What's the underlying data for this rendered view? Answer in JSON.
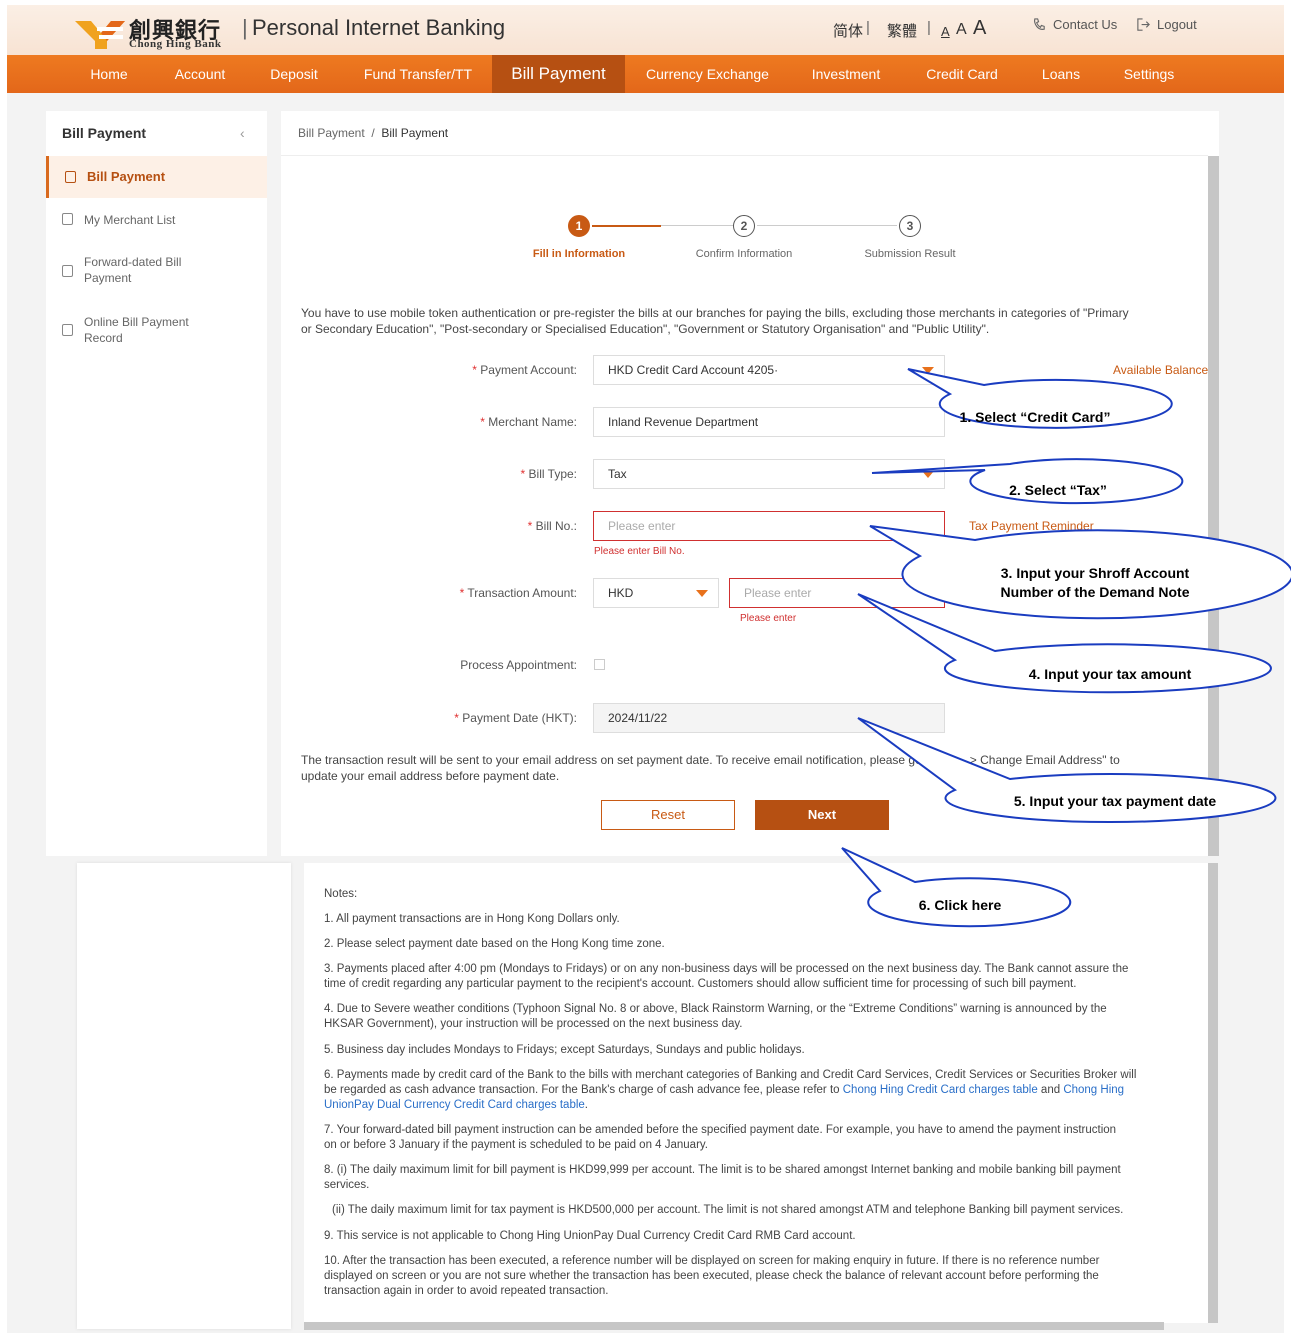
{
  "header": {
    "logo_cn": "創興銀行",
    "logo_en": "Chong Hing Bank",
    "title": "Personal Internet Banking",
    "lang_simplified": "简体",
    "lang_traditional": "繁體",
    "font_small": "A",
    "font_medium": "A",
    "font_large": "A",
    "contact_us": "Contact Us",
    "logout": "Logout"
  },
  "nav": [
    {
      "label": "Home"
    },
    {
      "label": "Account"
    },
    {
      "label": "Deposit"
    },
    {
      "label": "Fund Transfer/TT"
    },
    {
      "label": "Bill Payment"
    },
    {
      "label": "Currency Exchange"
    },
    {
      "label": "Investment"
    },
    {
      "label": "Credit Card"
    },
    {
      "label": "Loans"
    },
    {
      "label": "Settings"
    }
  ],
  "sidebar": {
    "title": "Bill Payment",
    "collapse": "‹",
    "items": [
      {
        "label": "Bill Payment",
        "active": true
      },
      {
        "label": "My Merchant List"
      },
      {
        "label": "Forward-dated Bill",
        "label2": "Payment"
      },
      {
        "label": "Online Bill Payment",
        "label2": "Record"
      }
    ]
  },
  "breadcrumb": {
    "parent": "Bill Payment",
    "separator": "/",
    "current": "Bill Payment"
  },
  "steps": [
    {
      "num": "1",
      "label": "Fill in Information"
    },
    {
      "num": "2",
      "label": "Confirm Information"
    },
    {
      "num": "3",
      "label": "Submission Result"
    }
  ],
  "intro": {
    "line1": "You have to use mobile token authentication or pre-register the bills at our branches for paying the bills, excluding those merchants in categories of \"Primary",
    "line2": "or Secondary Education\", \"Post-secondary or Specialised Education\", \"Government or Statutory Organisation\" and \"Public Utility\"."
  },
  "form": {
    "required_mark": "*",
    "payment_account_label": "Payment Account:",
    "payment_account_value": "HKD Credit Card Account 4205·",
    "available_balance": "Available Balance",
    "merchant_label": "Merchant Name:",
    "merchant_value": "Inland Revenue Department",
    "bill_type_label": "Bill Type:",
    "bill_type_value": "Tax",
    "bill_no_label": "Bill No.:",
    "bill_no_placeholder": "Please enter",
    "bill_no_error": "Please enter Bill No.",
    "tax_reminder": "Tax Payment Reminder",
    "amount_label": "Transaction Amount:",
    "currency": "HKD",
    "amount_placeholder": "Please enter",
    "amount_error": "Please enter",
    "appointment_label": "Process Appointment:",
    "date_label": "Payment Date (HKT):",
    "date_value": "2024/11/22"
  },
  "email_notice": {
    "line1a": "The transaction result will be sent to your email address on set payment date. To receive email notification, please go",
    "line1b": "> Change Email Address\" to",
    "line2": "update your email address before payment date."
  },
  "buttons": {
    "reset": "Reset",
    "next": "Next"
  },
  "callouts": [
    {
      "text": "1. Select “Credit Card”"
    },
    {
      "text": "2. Select “Tax”"
    },
    {
      "text": "3. Input your Shroff Account",
      "text2": "Number of the Demand Note"
    },
    {
      "text": "4. Input your tax amount"
    },
    {
      "text": "5. Input your tax payment date"
    },
    {
      "text": "6. Click here"
    }
  ],
  "notes": {
    "title": "Notes:",
    "n1": "1. All payment transactions are in Hong Kong Dollars only.",
    "n2": "2. Please select payment date based on the Hong Kong time zone.",
    "n3a": "3. Payments placed after 4:00 pm (Mondays to Fridays) or on any non-business days will be processed on the next business day. The Bank cannot assure the",
    "n3b": "time of credit regarding any particular payment to the recipient's account. Customers should allow sufficient time for processing of such bill payment.",
    "n4a": "4. Due to Severe weather conditions (Typhoon Signal No. 8 or above, Black Rainstorm Warning, or the “Extreme Conditions” warning is announced by the",
    "n4b": "HKSAR Government), your instruction will be processed on the next business day.",
    "n5": "5. Business day includes Mondays to Fridays; except Saturdays, Sundays and public holidays.",
    "n6a": "6. Payments made by credit card of the Bank to the bills with merchant categories of Banking and Credit Card Services, Credit Services or Securities Broker will",
    "n6b": "be regarded as cash advance transaction. For the Bank's charge of cash advance fee, please refer to",
    "n6_link1": "Chong Hing Credit Card charges table",
    "n6_and": "and",
    "n6_link2a": "Chong Hing",
    "n6_link2b": "UnionPay Dual Currency Credit Card charges table",
    "n6_end": ".",
    "n7a": "7. Your forward-dated bill payment instruction can be amended before the specified payment date. For example, you have to amend the payment instruction",
    "n7b": "on or before 3 January if the payment is scheduled to be paid on 4 January.",
    "n8a": "8. (i) The daily maximum limit for bill payment is HKD99,999 per account. The limit is to be shared amongst Internet banking and mobile banking bill payment",
    "n8b": "services.",
    "n8ii": "(ii) The daily maximum limit for tax payment is HKD500,000 per account. The limit is not shared amongst ATM and telephone Banking bill payment services.",
    "n9": "9. This service is not applicable to Chong Hing UnionPay Dual Currency Credit Card RMB Card account.",
    "n10a": "10. After the transaction has been executed, a reference number will be displayed on screen for making enquiry in future. If there is no reference number",
    "n10b": "displayed on screen or you are not sure whether the transaction has been executed, please check the balance of relevant account before performing the",
    "n10c": "transaction again in order to avoid repeated transaction."
  }
}
